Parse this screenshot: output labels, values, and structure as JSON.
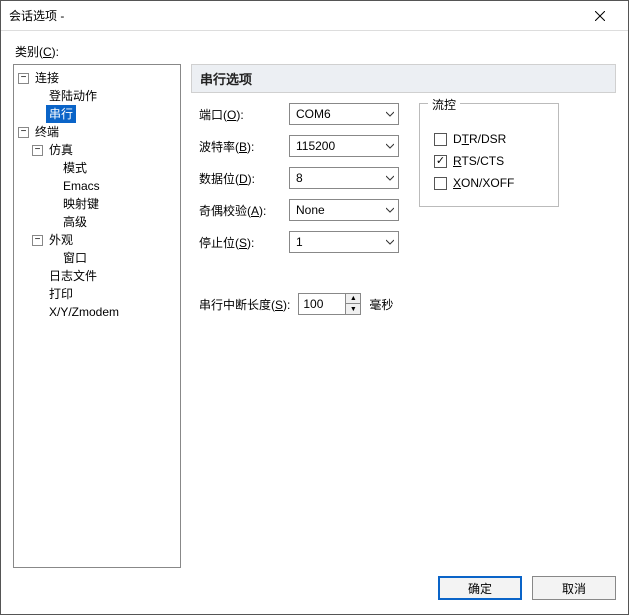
{
  "window": {
    "title": "会话选项 - "
  },
  "category_label": {
    "text": "类别(",
    "hotkey": "C",
    "suffix": "):"
  },
  "tree": {
    "connection": {
      "label": "连接",
      "login": "登陆动作",
      "serial": "串行"
    },
    "terminal": {
      "label": "终端",
      "emulation": "仿真",
      "mode": "模式",
      "emacs": "Emacs",
      "mapkey": "映射键",
      "advanced": "高级",
      "appearance": "外观",
      "window": "窗口",
      "logfile": "日志文件",
      "print": "打印",
      "xyz": "X/Y/Zmodem"
    }
  },
  "section": {
    "title": "串行选项"
  },
  "fields": {
    "port": {
      "label": "端口(",
      "hot": "O",
      "suffix": "):",
      "value": "COM6"
    },
    "baud": {
      "label": "波特率(",
      "hot": "B",
      "suffix": "):",
      "value": "115200"
    },
    "databits": {
      "label": "数据位(",
      "hot": "D",
      "suffix": "):",
      "value": "8"
    },
    "parity": {
      "label": "奇偶校验(",
      "hot": "A",
      "suffix": "):",
      "value": "None"
    },
    "stopbits": {
      "label": "停止位(",
      "hot": "S",
      "suffix": "):",
      "value": "1"
    }
  },
  "flow": {
    "legend": "流控",
    "dtr": {
      "label_pre": "D",
      "hot": "T",
      "label_post": "R/DSR",
      "checked": false
    },
    "rts": {
      "hot": "R",
      "label_post": "TS/CTS",
      "checked": true
    },
    "xon": {
      "hot": "X",
      "label_post": "ON/XOFF",
      "checked": false
    }
  },
  "break_row": {
    "label": "串行中断长度(",
    "hot": "S",
    "suffix": "):",
    "value": "100",
    "unit": "毫秒"
  },
  "buttons": {
    "ok": "确定",
    "cancel": "取消"
  },
  "glyphs": {
    "minus": "−"
  }
}
